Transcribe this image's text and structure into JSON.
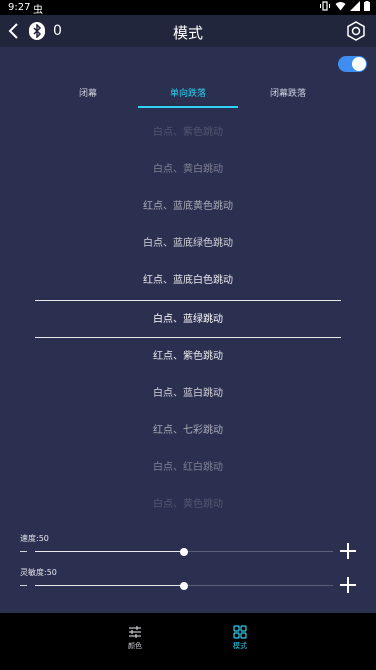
{
  "status_bar": {
    "time": "9:27",
    "notification": "虫"
  },
  "header": {
    "title": "模式",
    "device_count": "0"
  },
  "power_toggle": {
    "on": true
  },
  "tabs": [
    {
      "label": "闭幕"
    },
    {
      "label": "单向跌落"
    },
    {
      "label": "闭幕跌落"
    }
  ],
  "active_tab_index": 1,
  "modes": [
    {
      "label": "白点、紫色跳动"
    },
    {
      "label": "白点、黄白跳动"
    },
    {
      "label": "红点、蓝底黄色跳动"
    },
    {
      "label": "白点、蓝底绿色跳动"
    },
    {
      "label": "红点、蓝底白色跳动"
    },
    {
      "label": "白点、蓝绿跳动"
    },
    {
      "label": "红点、紫色跳动"
    },
    {
      "label": "白点、蓝白跳动"
    },
    {
      "label": "红点、七彩跳动"
    },
    {
      "label": "白点、红白跳动"
    },
    {
      "label": "白点、黄色跳动"
    }
  ],
  "selected_mode_index": 5,
  "speed": {
    "label": "速度:50",
    "value": 50,
    "max": 100
  },
  "sensitivity": {
    "label": "灵敏度:50",
    "value": 50,
    "max": 100
  },
  "bottom_nav": [
    {
      "label": "颜色",
      "icon": "sliders-icon",
      "active": false
    },
    {
      "label": "模式",
      "icon": "grid-icon",
      "active": true
    }
  ],
  "colors": {
    "accent": "#2fd2f2",
    "toggle": "#3d8ef0",
    "background": "#2c3050",
    "header": "#22263c"
  }
}
